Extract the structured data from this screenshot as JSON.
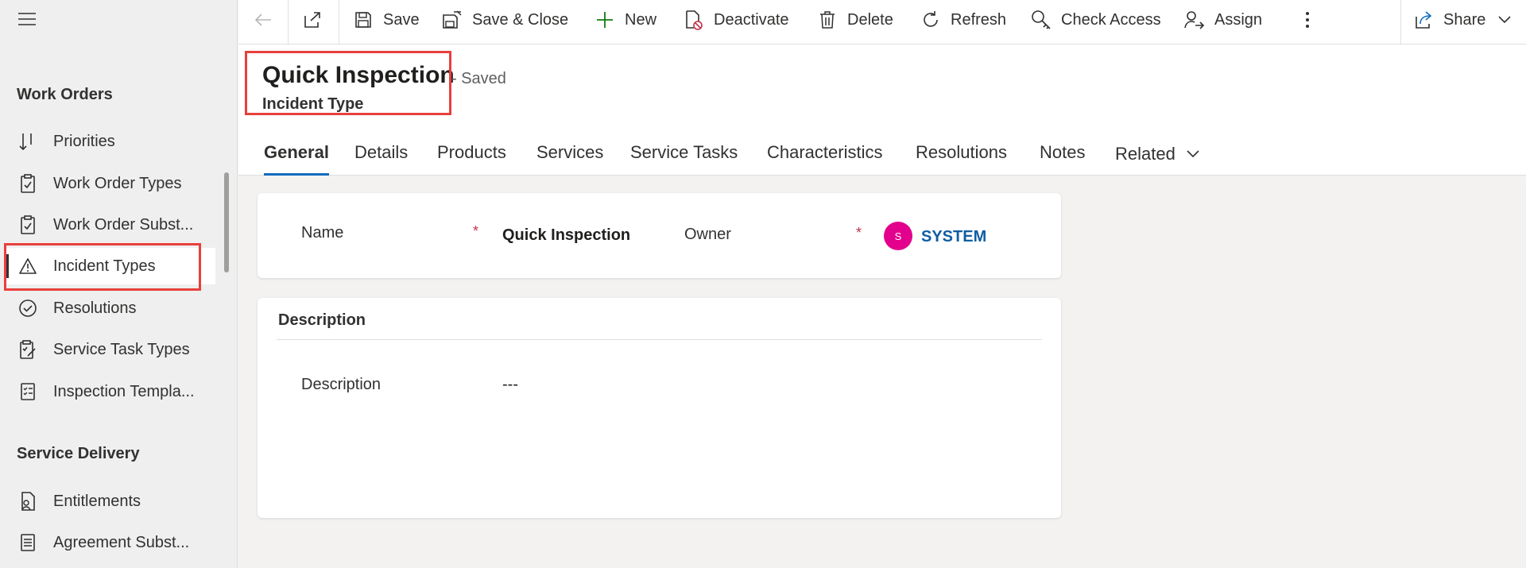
{
  "sidebar": {
    "sections": [
      {
        "title": "Work Orders",
        "items": [
          {
            "label": "Priorities",
            "icon": "sort-down-icon"
          },
          {
            "label": "Work Order Types",
            "icon": "clipboard-icon"
          },
          {
            "label": "Work Order Subst...",
            "icon": "clipboard-icon"
          },
          {
            "label": "Incident Types",
            "icon": "warning-icon",
            "selected": true
          },
          {
            "label": "Resolutions",
            "icon": "check-circle-icon"
          },
          {
            "label": "Service Task Types",
            "icon": "task-edit-icon"
          },
          {
            "label": "Inspection Templa...",
            "icon": "checklist-icon"
          }
        ]
      },
      {
        "title": "Service Delivery",
        "items": [
          {
            "label": "Entitlements",
            "icon": "document-person-icon"
          },
          {
            "label": "Agreement Subst...",
            "icon": "document-icon"
          }
        ]
      }
    ]
  },
  "commandbar": {
    "save": "Save",
    "save_close": "Save & Close",
    "new": "New",
    "deactivate": "Deactivate",
    "delete": "Delete",
    "refresh": "Refresh",
    "check_access": "Check Access",
    "assign": "Assign",
    "share": "Share"
  },
  "header": {
    "title": "Quick Inspection",
    "saved_status": "- Saved",
    "entity": "Incident Type"
  },
  "tabs": [
    "General",
    "Details",
    "Products",
    "Services",
    "Service Tasks",
    "Characteristics",
    "Resolutions",
    "Notes",
    "Related"
  ],
  "active_tab": "General",
  "general": {
    "name_label": "Name",
    "name_value": "Quick Inspection",
    "owner_label": "Owner",
    "owner_initial": "S",
    "owner_value": "SYSTEM",
    "required_mark": "*"
  },
  "description_section": {
    "title": "Description",
    "field_label": "Description",
    "field_value": "---"
  },
  "colors": {
    "accent": "#0f6cbd",
    "highlight_box": "#e8403c",
    "avatar": "#e3008c",
    "required": "#c4314b",
    "link": "#115ea3"
  }
}
